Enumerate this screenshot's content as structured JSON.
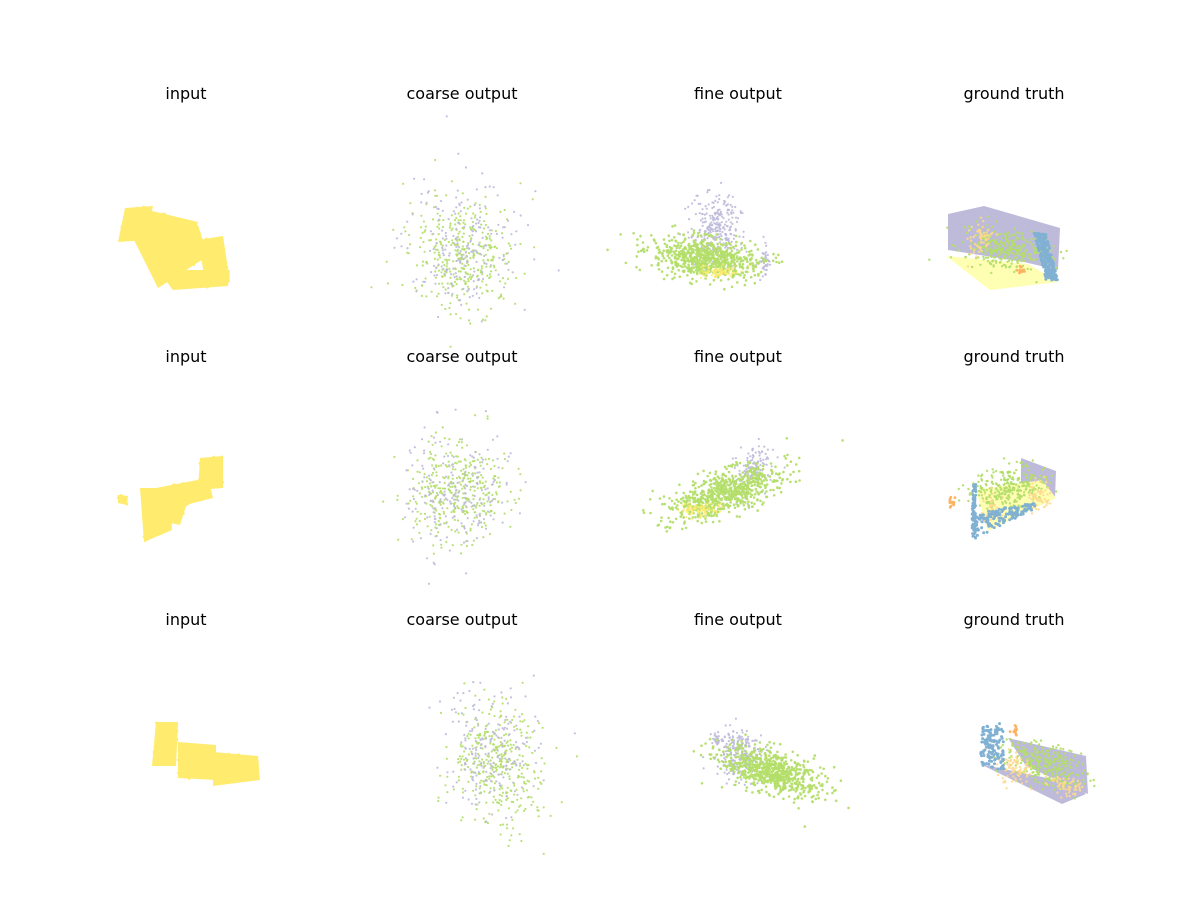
{
  "figure": {
    "background": "#ffffff",
    "rows": [
      {
        "panels": [
          {
            "title": "input",
            "kind": "input",
            "variant": 0
          },
          {
            "title": "coarse output",
            "kind": "coarse",
            "variant": 0
          },
          {
            "title": "fine output",
            "kind": "fine",
            "variant": 0
          },
          {
            "title": "ground truth",
            "kind": "gt",
            "variant": 0
          }
        ]
      },
      {
        "panels": [
          {
            "title": "input",
            "kind": "input",
            "variant": 1
          },
          {
            "title": "coarse output",
            "kind": "coarse",
            "variant": 1
          },
          {
            "title": "fine output",
            "kind": "fine",
            "variant": 1
          },
          {
            "title": "ground truth",
            "kind": "gt",
            "variant": 1
          }
        ]
      },
      {
        "panels": [
          {
            "title": "input",
            "kind": "input",
            "variant": 2
          },
          {
            "title": "coarse output",
            "kind": "coarse",
            "variant": 2
          },
          {
            "title": "fine output",
            "kind": "fine",
            "variant": 2
          },
          {
            "title": "ground truth",
            "kind": "gt",
            "variant": 2
          }
        ]
      }
    ]
  },
  "colors": {
    "yellow": "#ffeb6e",
    "green": "#b3de69",
    "lavender": "#bebada",
    "pale_yellow": "#ffffb3",
    "blue": "#80b1d3",
    "orange": "#fdb462",
    "light_orange": "#fed98e"
  }
}
